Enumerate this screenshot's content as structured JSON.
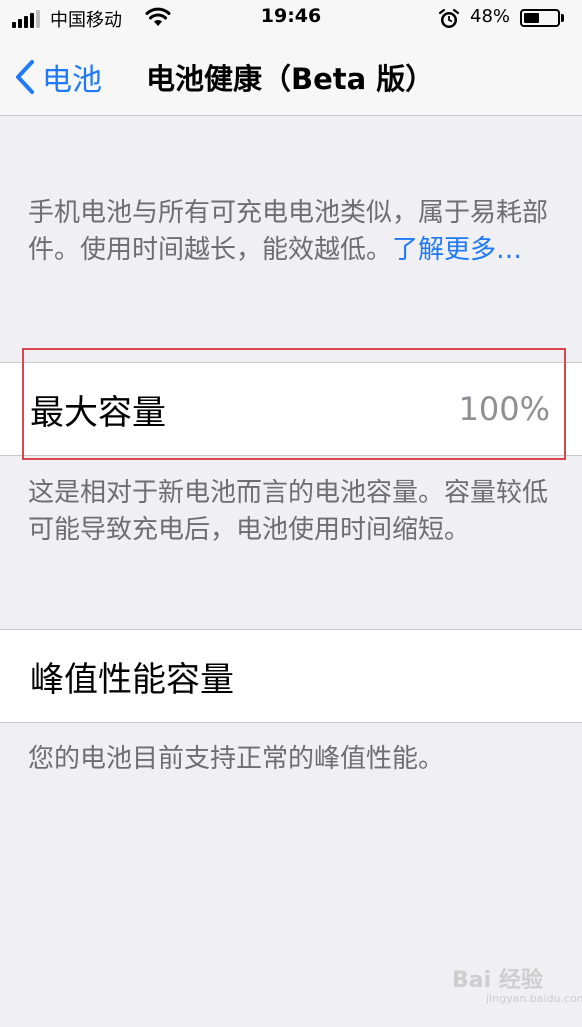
{
  "status_bar": {
    "carrier": "中国移动",
    "time": "19:46",
    "battery_percent_text": "48%",
    "battery_level": 0.48,
    "icons": [
      "signal-icon",
      "wifi-icon",
      "alarm-icon",
      "battery-icon"
    ]
  },
  "nav": {
    "back_label": "电池",
    "title": "电池健康（Beta 版）",
    "back_icon": "chevron-left-icon"
  },
  "intro": {
    "text": "手机电池与所有可充电电池类似，属于易耗部件。使用时间越长，能效越低。",
    "learn_more": "了解更多…"
  },
  "max_capacity": {
    "label": "最大容量",
    "value": "100%",
    "description": "这是相对于新电池而言的电池容量。容量较低可能导致充电后，电池使用时间缩短。"
  },
  "peak_performance": {
    "label": "峰值性能容量",
    "description": "您的电池目前支持正常的峰值性能。"
  },
  "watermark": {
    "text": "Bai 经验",
    "subtext": "jingyan.baidu.com"
  },
  "colors": {
    "accent": "#1f7af7",
    "highlight": "#d9464f",
    "background": "#efeff4"
  }
}
